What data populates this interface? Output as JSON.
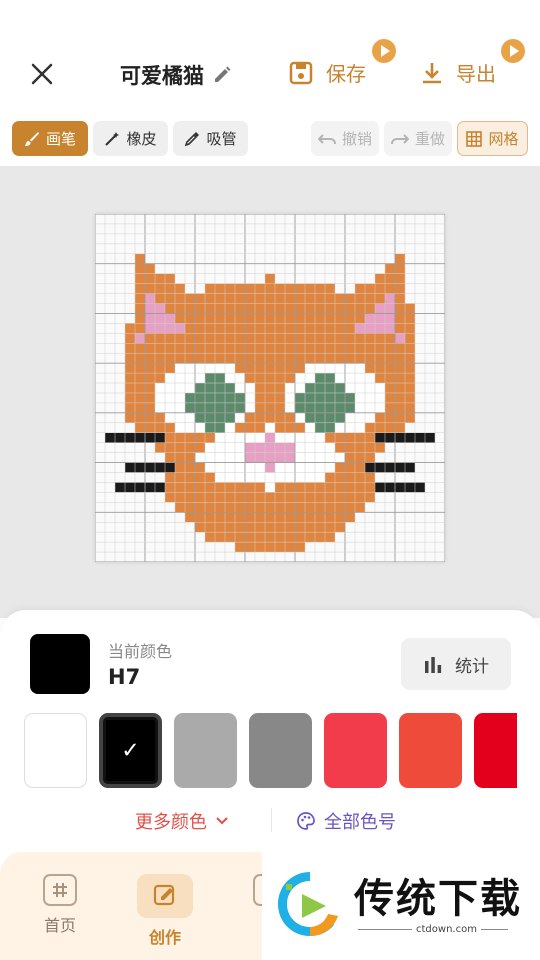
{
  "header": {
    "title": "可爱橘猫",
    "save_label": "保存",
    "export_label": "导出"
  },
  "toolbar": {
    "brush": "画笔",
    "eraser": "橡皮",
    "picker": "吸管",
    "undo": "撤销",
    "redo": "重做",
    "grid": "网格"
  },
  "current_color": {
    "label": "当前颜色",
    "code": "H7",
    "hex": "#000000"
  },
  "stats_label": "统计",
  "palette": [
    {
      "hex": "#ffffff",
      "selected": false
    },
    {
      "hex": "#000000",
      "selected": true
    },
    {
      "hex": "#aaaaaa",
      "selected": false
    },
    {
      "hex": "#888888",
      "selected": false
    },
    {
      "hex": "#f23b4b",
      "selected": false
    },
    {
      "hex": "#ee4b3b",
      "selected": false
    },
    {
      "hex": "#e3001d",
      "selected": false
    }
  ],
  "more_colors_label": "更多颜色",
  "all_codes_label": "全部色号",
  "nav": {
    "home": "首页",
    "create": "创作"
  },
  "watermark": {
    "text": "传统下载",
    "sub": "ctdown.com"
  },
  "colors": {
    "accent": "#c8832f",
    "orange": "#e0853f",
    "pink": "#e6a0c3",
    "green": "#5c8a6a",
    "black": "#1a1a1a"
  }
}
